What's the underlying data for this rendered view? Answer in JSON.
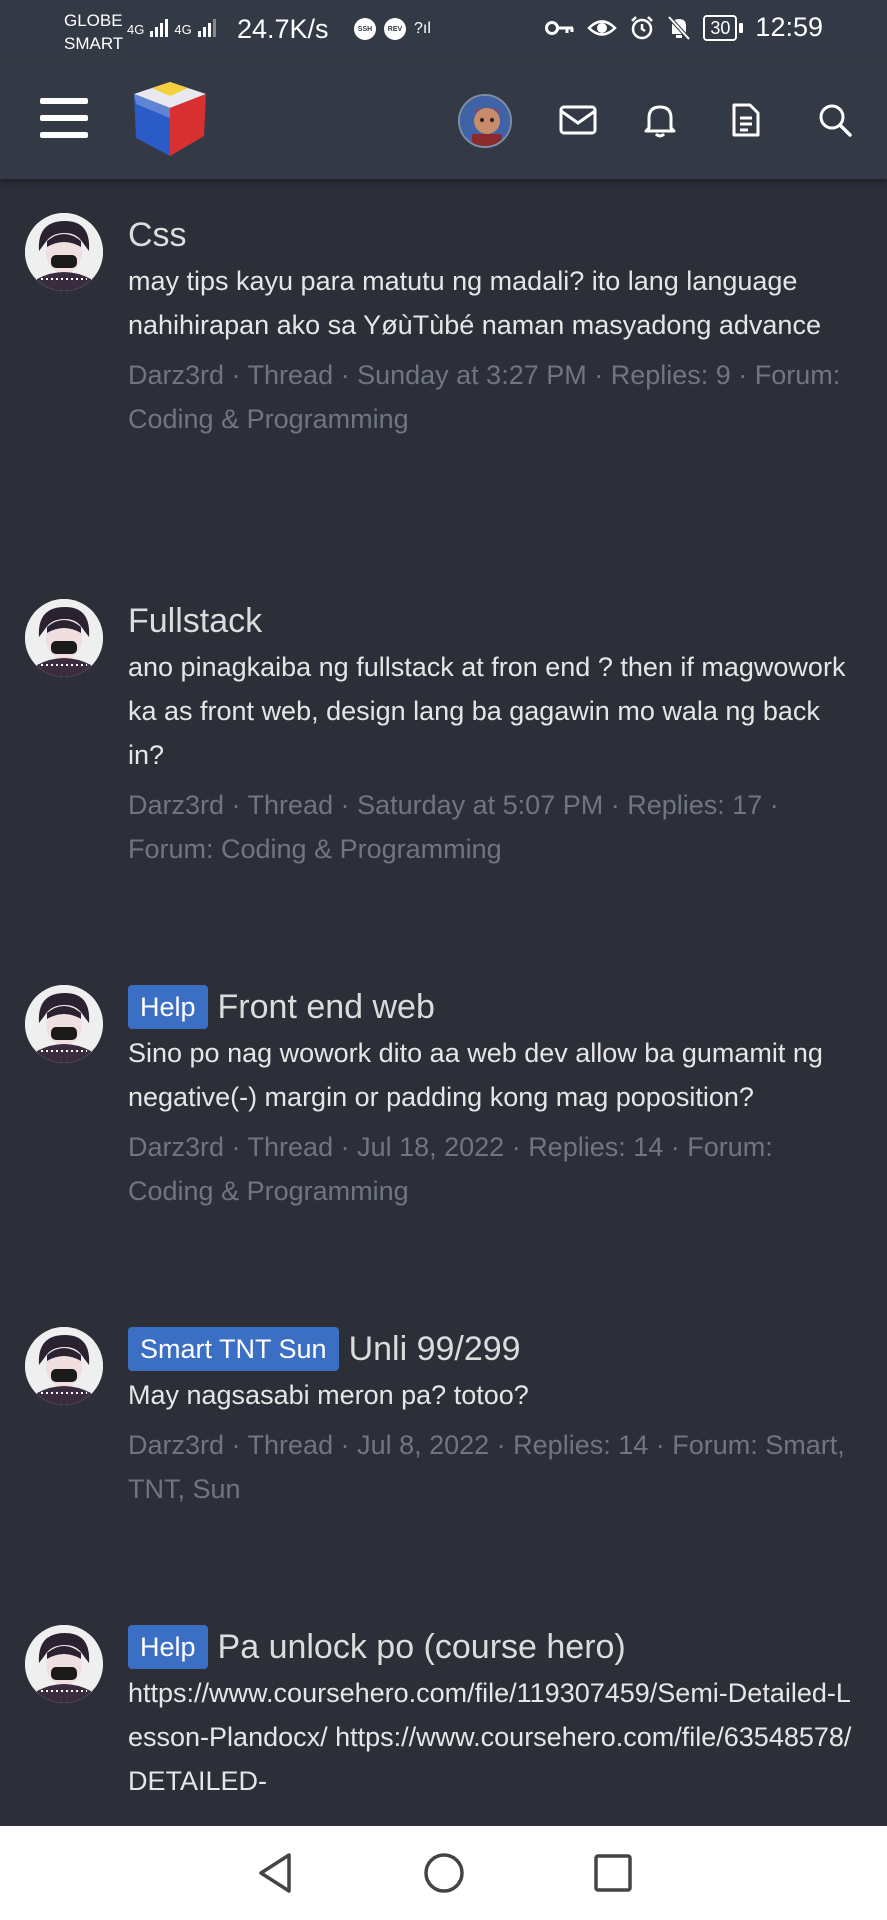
{
  "status_bar": {
    "carrier1": "GLOBE",
    "carrier2": "SMART",
    "net1": "4G",
    "net2": "4G",
    "speed": "24.7K/s",
    "app_badge1": "SSH",
    "app_badge2": "REV",
    "battery": "30",
    "time": "12:59",
    "icons": [
      "key-icon",
      "eye-icon",
      "alarm-icon",
      "bell-off-icon"
    ]
  },
  "header": {
    "icons": [
      "menu-icon",
      "site-logo",
      "user-avatar",
      "inbox-icon",
      "bell-icon",
      "document-icon",
      "search-icon"
    ]
  },
  "threads": [
    {
      "title": "Css",
      "prefix": "",
      "snippet": "may tips kayu para matutu ng madali? ito lang language nahihirapan ako sa YøùTùbé naman masyadong advance",
      "meta": "Darz3rd · Thread · Sunday at 3:27 PM · Replies: 9 · Forum: Coding & Programming"
    },
    {
      "title": "Fullstack",
      "prefix": "",
      "snippet": "ano pinagkaiba ng fullstack at fron end ? then if magwowork ka as front web, design lang ba gagawin mo wala ng back in?",
      "meta": "Darz3rd · Thread · Saturday at 5:07 PM · Replies: 17 · Forum: Coding & Programming"
    },
    {
      "title": "Front end web",
      "prefix": "Help",
      "snippet": "Sino po nag wowork dito aa web dev allow ba gumamit ng negative(-) margin or padding kong mag poposition?",
      "meta": "Darz3rd · Thread · Jul 18, 2022 · Replies: 14 · Forum: Coding & Programming"
    },
    {
      "title": "Unli 99/299",
      "prefix": "Smart TNT Sun",
      "snippet": "May nagsasabi meron pa? totoo?",
      "meta": "Darz3rd · Thread · Jul 8, 2022 · Replies: 14 · Forum: Smart, TNT, Sun"
    },
    {
      "title": "Pa unlock po (course hero)",
      "prefix": "Help",
      "snippet": "https://www.coursehero.com/file/119307459/Semi-Detailed-Lesson-Plandocx/ https://www.coursehero.com/file/63548578/DETAILED-",
      "meta": ""
    }
  ],
  "nav": [
    "back-icon",
    "home-icon",
    "recents-icon"
  ]
}
